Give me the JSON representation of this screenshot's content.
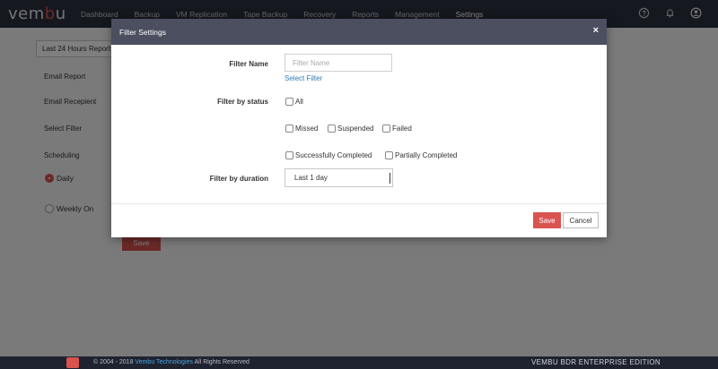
{
  "app": {
    "logo": {
      "left": "vem",
      "mid": "b",
      "right": "u"
    },
    "nav": [
      "Dashboard",
      "Backup",
      "VM Replication",
      "Tape Backup",
      "Recovery",
      "Reports",
      "Management",
      "Settings"
    ],
    "active_nav": "Settings",
    "top_icons": [
      "help-icon",
      "bell-icon",
      "user-icon"
    ]
  },
  "page": {
    "range_select": "Last 24 Hours Report",
    "labels": {
      "email_report": "Email Report",
      "email_recepient": "Email Recepient",
      "select_filter": "Select Filter",
      "scheduling": "Scheduling"
    },
    "schedule_options": [
      {
        "label": "Daily",
        "checked": true
      },
      {
        "label": "Weekly On",
        "checked": false
      }
    ],
    "save_label": "Save"
  },
  "modal": {
    "title": "Filter Settings",
    "close": "×",
    "filter_name_label": "Filter Name",
    "filter_name_placeholder": "Filter Name",
    "filter_name_value": "",
    "select_filter_link": "Select Filter",
    "filter_status_label": "Filter by status",
    "status_options": {
      "all": "All",
      "missed": "Missed",
      "suspended": "Suspended",
      "failed": "Failed",
      "successfully_completed": "Successfully Completed",
      "partially_completed": "Partially Completed"
    },
    "filter_duration_label": "Filter by duration",
    "duration_selected": "Last 1 day",
    "save_label": "Save",
    "cancel_label": "Cancel"
  },
  "footer": {
    "copyright_prefix": "© 2004 - 2018",
    "company": "Vembu Technologies",
    "rights": "All Rights Reserved",
    "edition": "VEMBU BDR ENTERPRISE EDITION"
  },
  "colors": {
    "accent": "#d9534f",
    "nav_bg": "#2c3141",
    "modal_header_bg": "#4b4f5f",
    "link": "#2a7ab8"
  }
}
